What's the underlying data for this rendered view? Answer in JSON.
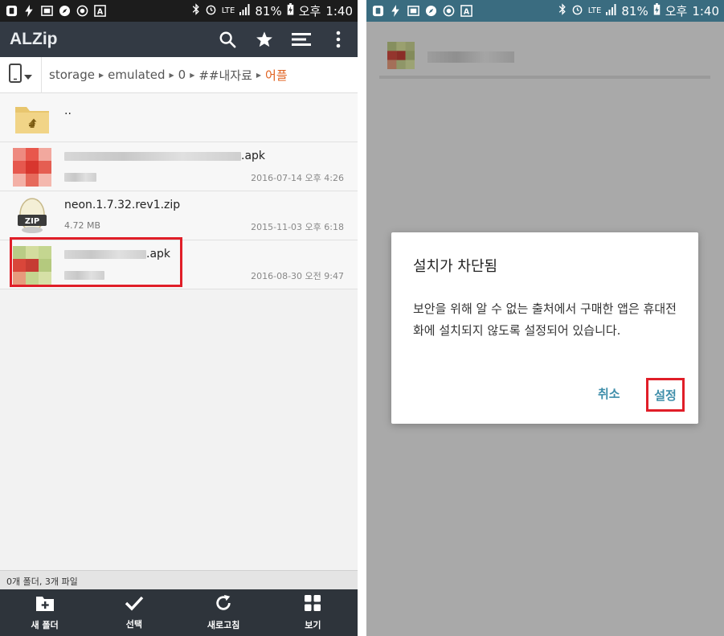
{
  "status_bar": {
    "battery": "81%",
    "ampm": "오후",
    "time": "1:40",
    "network": "LTE"
  },
  "alzip": {
    "title": "ALZip",
    "path": [
      "storage",
      "emulated",
      "0",
      "##내자료",
      "어플"
    ],
    "files": [
      {
        "name": "..",
        "size": "",
        "date": ""
      },
      {
        "name_suffix": ".apk",
        "size": "",
        "date": "2016-07-14 오후 4:26"
      },
      {
        "name": "neon.1.7.32.rev1.zip",
        "size": "4.72 MB",
        "date": "2015-11-03 오후 6:18"
      },
      {
        "name_suffix": ".apk",
        "size": "",
        "date": "2016-08-30 오전 9:47"
      }
    ],
    "zip_badge": "ZIP",
    "summary": "0개 폴더, 3개 파일",
    "bottom": {
      "new_folder": "새 폴더",
      "select": "선택",
      "refresh": "새로고침",
      "view": "보기"
    },
    "icons": {
      "search": "search-icon",
      "star": "star-icon",
      "menu": "menu-icon",
      "more": "more-vert-icon"
    }
  },
  "dialog": {
    "title": "설치가 차단됨",
    "message": "보안을 위해 알 수 없는 출처에서 구매한 앱은 휴대전화에 설치되지 않도록 설정되어 있습니다.",
    "cancel": "취소",
    "settings": "설정"
  },
  "colors": {
    "alzip_header": "#333a44",
    "path_current": "#e0611f",
    "highlight": "#e01e28",
    "dialog_button": "#3f8eaa",
    "right_status": "#3a6c80"
  }
}
